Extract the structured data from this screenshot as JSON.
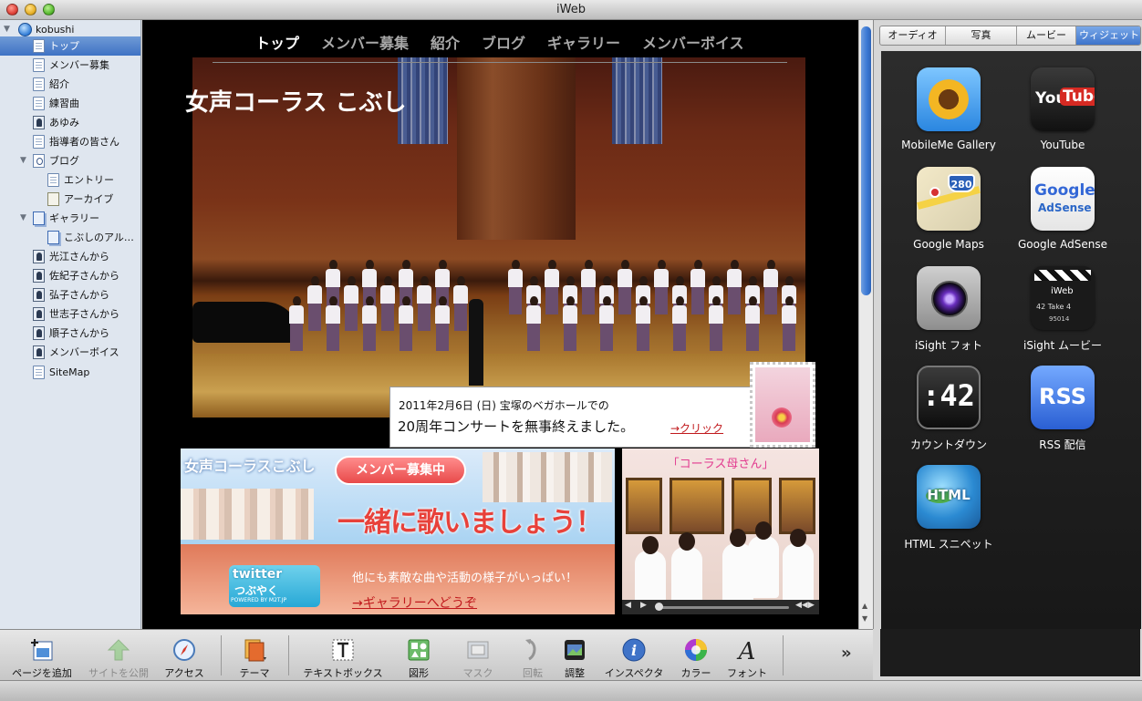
{
  "window": {
    "title": "iWeb"
  },
  "sidebar": {
    "site": "kobushi",
    "items": [
      {
        "label": "トップ",
        "icon": "page-icon",
        "selected": true
      },
      {
        "label": "メンバー募集",
        "icon": "page-icon"
      },
      {
        "label": "紹介",
        "icon": "page-icon"
      },
      {
        "label": "練習曲",
        "icon": "page-icon"
      },
      {
        "label": "あゆみ",
        "icon": "person-page-icon"
      },
      {
        "label": "指導者の皆さん",
        "icon": "page-icon"
      },
      {
        "label": "ブログ",
        "icon": "blog-icon"
      },
      {
        "label": "エントリー",
        "icon": "page-icon"
      },
      {
        "label": "アーカイブ",
        "icon": "archive-icon"
      },
      {
        "label": "ギャラリー",
        "icon": "gallery-icon"
      },
      {
        "label": "こぶしのアル…",
        "icon": "gallery-icon"
      },
      {
        "label": "光江さんから",
        "icon": "person-page-icon"
      },
      {
        "label": "佐紀子さんから",
        "icon": "person-page-icon"
      },
      {
        "label": "弘子さんから",
        "icon": "person-page-icon"
      },
      {
        "label": "世志子さんから",
        "icon": "person-page-icon"
      },
      {
        "label": "順子さんから",
        "icon": "person-page-icon"
      },
      {
        "label": "メンバーボイス",
        "icon": "person-page-icon"
      },
      {
        "label": "SiteMap",
        "icon": "page-icon"
      }
    ]
  },
  "page": {
    "nav": [
      "トップ",
      "メンバー募集",
      "紹介",
      "ブログ",
      "ギャラリー",
      "メンバーボイス"
    ],
    "site_title": "女声コーラス こぶし",
    "caption": {
      "line1": "2011年2月6日 (日) 宝塚のベガホールでの",
      "line2": "20周年コンサートを無事終えました。",
      "link": "→クリック"
    },
    "banner": {
      "name": "女声コーラスこぶし",
      "pill": "メンバー募集中",
      "headline": "一緒に歌いましょう！",
      "more": "他にも素敵な曲や活動の様子がいっぱい！",
      "gallery_link": "→ギャラリーへどうぞ"
    },
    "twitter": {
      "line1": "twitter",
      "line2": "つぶやく",
      "line3": "POWERED BY M2T.JP"
    },
    "video": {
      "title": "「コーラス母さん」"
    }
  },
  "right_panel": {
    "tabs": [
      {
        "label": "オーディオ"
      },
      {
        "label": "写真"
      },
      {
        "label": "ムービー"
      },
      {
        "label": "ウィジェット",
        "active": true
      }
    ],
    "widgets": [
      {
        "label": "MobileMe Gallery",
        "icon": "mobileme-gallery-icon"
      },
      {
        "label": "YouTube",
        "icon": "youtube-icon",
        "glyph_a": "You",
        "glyph_b": "Tube"
      },
      {
        "label": "Google Maps",
        "icon": "google-maps-icon",
        "glyph": "280"
      },
      {
        "label": "Google AdSense",
        "icon": "google-adsense-icon",
        "glyph_a": "Google",
        "glyph_b": "AdSense"
      },
      {
        "label": "iSight フォト",
        "icon": "isight-photo-icon"
      },
      {
        "label": "iSight ムービー",
        "icon": "isight-movie-icon",
        "glyph_a": "iWeb",
        "glyph_b": "42  Take 4",
        "glyph_c": "95014"
      },
      {
        "label": "カウントダウン",
        "icon": "countdown-icon",
        "glyph": ":42"
      },
      {
        "label": "RSS 配信",
        "icon": "rss-icon",
        "glyph": "RSS"
      },
      {
        "label": "HTML スニペット",
        "icon": "html-snippet-icon",
        "glyph": "HTML"
      }
    ]
  },
  "toolbar": {
    "add_page": "ページを追加",
    "publish": "サイトを公開",
    "access": "アクセス",
    "theme": "テーマ",
    "textbox": "テキストボックス",
    "shapes": "図形",
    "mask": "マスク",
    "rotate": "回転",
    "adjust": "調整",
    "inspector": "インスペクタ",
    "color": "カラー",
    "font": "フォント",
    "more": "»"
  }
}
